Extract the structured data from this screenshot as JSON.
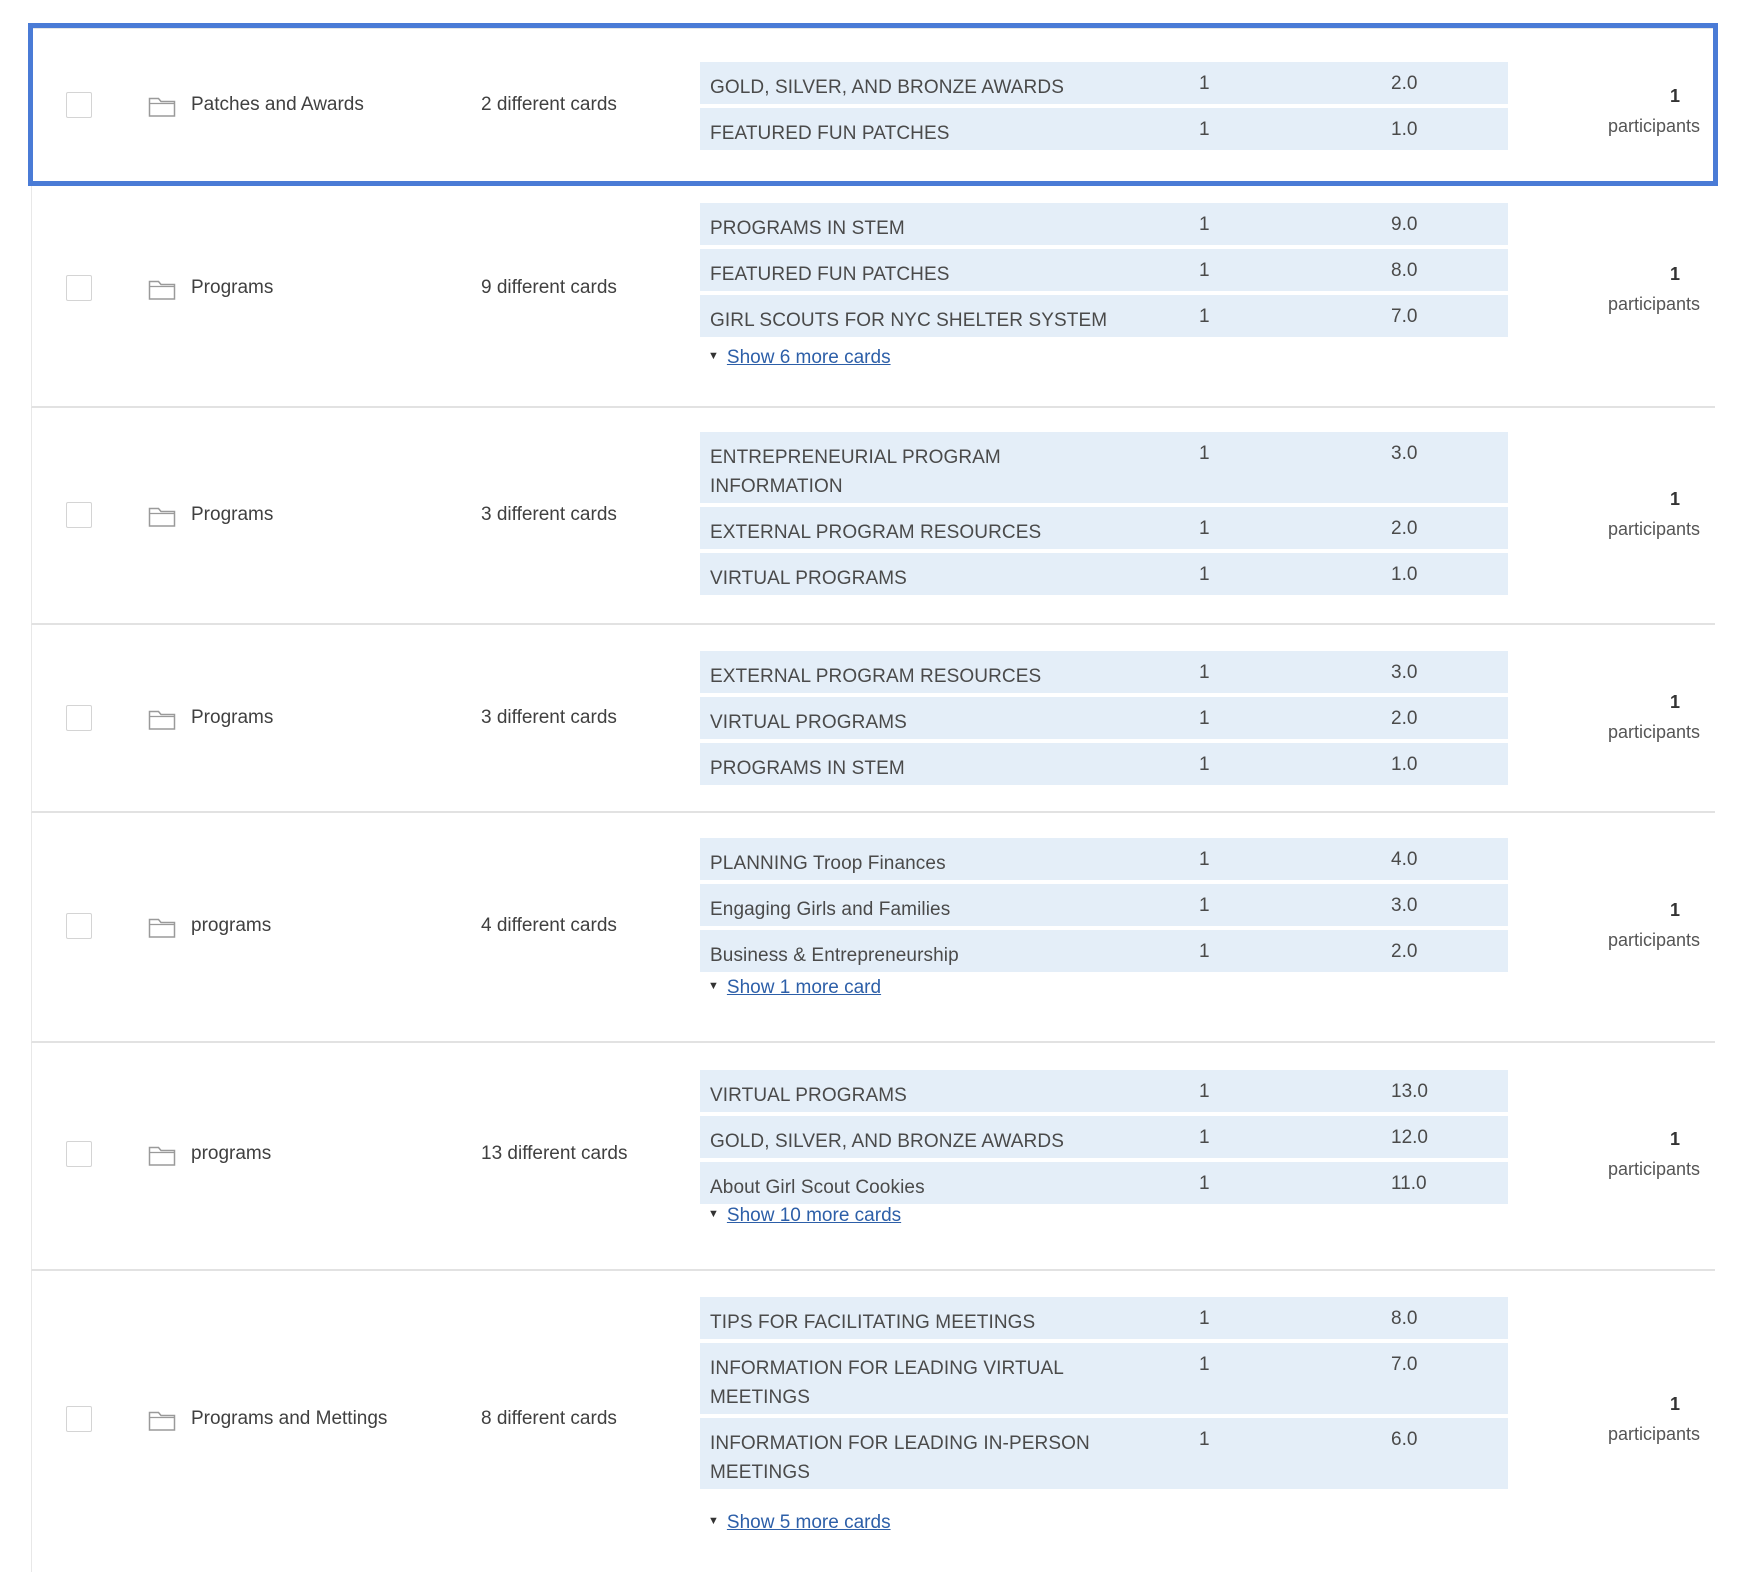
{
  "rows": [
    {
      "category": "Patches and Awards",
      "count_label": "2 different cards",
      "cards": [
        {
          "title": "GOLD, SILVER, AND BRONZE AWARDS",
          "col1": "1",
          "col2": "2.0"
        },
        {
          "title": "FEATURED FUN PATCHES",
          "col1": "1",
          "col2": "1.0"
        }
      ],
      "more_label": "",
      "participants_count": "1",
      "participants_label": "participants",
      "selected": true
    },
    {
      "category": "Programs",
      "count_label": "9 different cards",
      "cards": [
        {
          "title": "PROGRAMS IN STEM",
          "col1": "1",
          "col2": "9.0"
        },
        {
          "title": "FEATURED FUN PATCHES",
          "col1": "1",
          "col2": "8.0"
        },
        {
          "title": "GIRL SCOUTS FOR NYC SHELTER SYSTEM",
          "col1": "1",
          "col2": "7.0"
        }
      ],
      "more_label": "Show 6 more cards",
      "participants_count": "1",
      "participants_label": "participants"
    },
    {
      "category": "Programs",
      "count_label": "3 different cards",
      "cards": [
        {
          "title": "ENTREPRENEURIAL PROGRAM INFORMATION",
          "col1": "1",
          "col2": "3.0"
        },
        {
          "title": "EXTERNAL PROGRAM RESOURCES",
          "col1": "1",
          "col2": "2.0"
        },
        {
          "title": "VIRTUAL PROGRAMS",
          "col1": "1",
          "col2": "1.0"
        }
      ],
      "more_label": "",
      "participants_count": "1",
      "participants_label": "participants"
    },
    {
      "category": "Programs",
      "count_label": "3 different cards",
      "cards": [
        {
          "title": "EXTERNAL PROGRAM RESOURCES",
          "col1": "1",
          "col2": "3.0"
        },
        {
          "title": "VIRTUAL PROGRAMS",
          "col1": "1",
          "col2": "2.0"
        },
        {
          "title": "PROGRAMS IN STEM",
          "col1": "1",
          "col2": "1.0"
        }
      ],
      "more_label": "",
      "participants_count": "1",
      "participants_label": "participants"
    },
    {
      "category": "programs",
      "count_label": "4 different cards",
      "cards": [
        {
          "title": "PLANNING Troop Finances",
          "col1": "1",
          "col2": "4.0"
        },
        {
          "title": "Engaging Girls and Families",
          "col1": "1",
          "col2": "3.0"
        },
        {
          "title": "Business & Entrepreneurship",
          "col1": "1",
          "col2": "2.0"
        }
      ],
      "more_label": "Show 1 more card",
      "participants_count": "1",
      "participants_label": "participants"
    },
    {
      "category": "programs",
      "count_label": "13 different cards",
      "cards": [
        {
          "title": "VIRTUAL PROGRAMS",
          "col1": "1",
          "col2": "13.0"
        },
        {
          "title": "GOLD, SILVER, AND BRONZE AWARDS",
          "col1": "1",
          "col2": "12.0"
        },
        {
          "title": "About Girl Scout Cookies",
          "col1": "1",
          "col2": "11.0"
        }
      ],
      "more_label": "Show 10 more cards",
      "participants_count": "1",
      "participants_label": "participants"
    },
    {
      "category": "Programs and Mettings",
      "count_label": "8 different cards",
      "cards": [
        {
          "title": "TIPS FOR FACILITATING MEETINGS",
          "col1": "1",
          "col2": "8.0"
        },
        {
          "title": "INFORMATION FOR LEADING VIRTUAL MEETINGS",
          "col1": "1",
          "col2": "7.0"
        },
        {
          "title": "INFORMATION FOR LEADING IN-PERSON MEETINGS",
          "col1": "1",
          "col2": "6.0"
        }
      ],
      "more_label": "Show 5 more cards",
      "participants_count": "1",
      "participants_label": "participants"
    }
  ]
}
